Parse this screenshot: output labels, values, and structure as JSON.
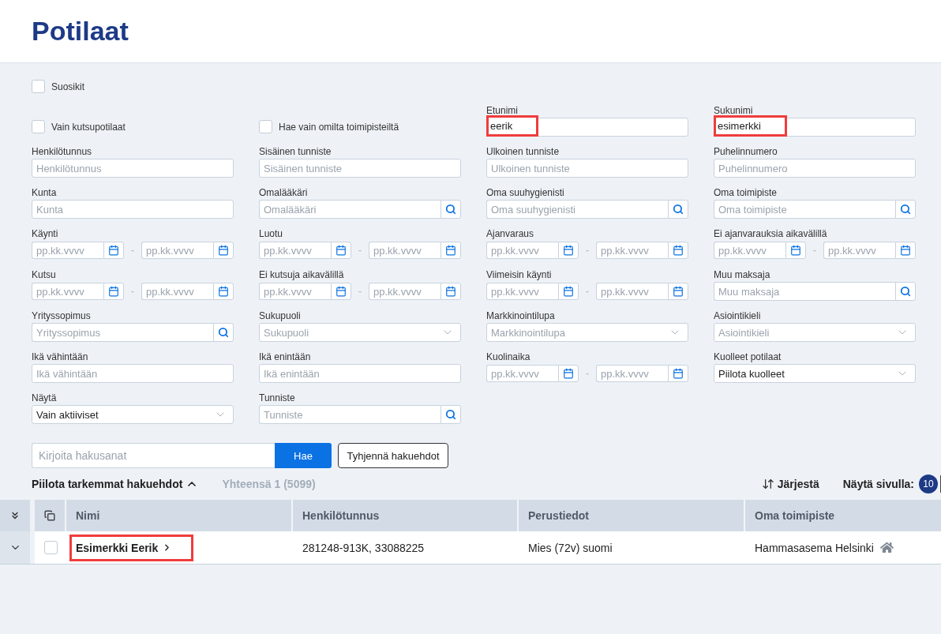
{
  "page": {
    "title": "Potilaat"
  },
  "filters": {
    "favorites": {
      "label": "Suosikit",
      "checked": false
    },
    "fields": [
      {
        "kind": "checkbox",
        "label": "Vain kutsupotilaat",
        "checked": false,
        "highlighted": false
      },
      {
        "kind": "checkbox",
        "label": "Hae vain omilta toimipisteiltä",
        "checked": false,
        "highlighted": false
      },
      {
        "kind": "text",
        "label": "Etunimi",
        "value": "eerik",
        "highlighted": true
      },
      {
        "kind": "text",
        "label": "Sukunimi",
        "value": "esimerkki",
        "highlighted": true
      },
      {
        "kind": "text",
        "label": "Henkilötunnus",
        "placeholder": "Henkilötunnus",
        "highlighted": false
      },
      {
        "kind": "text",
        "label": "Sisäinen tunniste",
        "placeholder": "Sisäinen tunniste",
        "highlighted": false
      },
      {
        "kind": "text",
        "label": "Ulkoinen tunniste",
        "placeholder": "Ulkoinen tunniste",
        "highlighted": false
      },
      {
        "kind": "text",
        "label": "Puhelinnumero",
        "placeholder": "Puhelinnumero",
        "highlighted": false
      },
      {
        "kind": "text",
        "label": "Kunta",
        "placeholder": "Kunta",
        "highlighted": false
      },
      {
        "kind": "lookup",
        "label": "Omalääkäri",
        "placeholder": "Omalääkäri",
        "highlighted": false
      },
      {
        "kind": "lookup",
        "label": "Oma suuhygienisti",
        "placeholder": "Oma suuhygienisti",
        "highlighted": false
      },
      {
        "kind": "lookup",
        "label": "Oma toimipiste",
        "placeholder": "Oma toimipiste",
        "highlighted": false
      },
      {
        "kind": "daterange",
        "label": "Käynti",
        "from": {
          "placeholder": "pp.kk.vvvv"
        },
        "separator": "-",
        "to": {
          "placeholder": "pp.kk.vvvv"
        },
        "highlighted": false
      },
      {
        "kind": "daterange",
        "label": "Luotu",
        "from": {
          "placeholder": "pp.kk.vvvv"
        },
        "separator": "-",
        "to": {
          "placeholder": "pp.kk.vvvv"
        },
        "highlighted": false
      },
      {
        "kind": "daterange",
        "label": "Ajanvaraus",
        "from": {
          "placeholder": "pp.kk.vvvv"
        },
        "separator": "-",
        "to": {
          "placeholder": "pp.kk.vvvv"
        },
        "highlighted": false
      },
      {
        "kind": "daterange",
        "label": "Ei ajanvarauksia aikavälillä",
        "from": {
          "placeholder": "pp.kk.vvvv"
        },
        "separator": "-",
        "to": {
          "placeholder": "pp.kk.vvvv"
        },
        "highlighted": false
      },
      {
        "kind": "daterange",
        "label": "Kutsu",
        "from": {
          "placeholder": "pp.kk.vvvv"
        },
        "separator": "-",
        "to": {
          "placeholder": "pp.kk.vvvv"
        },
        "highlighted": false
      },
      {
        "kind": "daterange",
        "label": "Ei kutsuja aikavälillä",
        "from": {
          "placeholder": "pp.kk.vvvv"
        },
        "separator": "-",
        "to": {
          "placeholder": "pp.kk.vvvv"
        },
        "highlighted": false
      },
      {
        "kind": "daterange",
        "label": "Viimeisin käynti",
        "from": {
          "placeholder": "pp.kk.vvvv"
        },
        "separator": "-",
        "to": {
          "placeholder": "pp.kk.vvvv"
        },
        "highlighted": false
      },
      {
        "kind": "lookup",
        "label": "Muu maksaja",
        "placeholder": "Muu maksaja",
        "highlighted": false
      },
      {
        "kind": "lookup",
        "label": "Yrityssopimus",
        "placeholder": "Yrityssopimus",
        "highlighted": false
      },
      {
        "kind": "select",
        "label": "Sukupuoli",
        "placeholder": "Sukupuoli",
        "highlighted": false
      },
      {
        "kind": "select",
        "label": "Markkinointilupa",
        "placeholder": "Markkinointilupa",
        "highlighted": false
      },
      {
        "kind": "select",
        "label": "Asiointikieli",
        "placeholder": "Asiointikieli",
        "highlighted": false
      },
      {
        "kind": "text",
        "label": "Ikä vähintään",
        "placeholder": "Ikä vähintään",
        "highlighted": false
      },
      {
        "kind": "text",
        "label": "Ikä enintään",
        "placeholder": "Ikä enintään",
        "highlighted": false
      },
      {
        "kind": "daterange",
        "label": "Kuolinaika",
        "from": {
          "placeholder": "pp.kk.vvvv"
        },
        "separator": "-",
        "to": {
          "placeholder": "pp.kk.vvvv"
        },
        "highlighted": false
      },
      {
        "kind": "select",
        "label": "Kuolleet potilaat",
        "value": "Piilota kuolleet",
        "highlighted": false
      },
      {
        "kind": "select",
        "label": "Näytä",
        "value": "Vain aktiiviset",
        "highlighted": false
      },
      {
        "kind": "lookup",
        "label": "Tunniste",
        "placeholder": "Tunniste",
        "highlighted": false
      }
    ]
  },
  "search": {
    "placeholder": "Kirjoita hakusanat",
    "button": "Hae",
    "clear_button": "Tyhjennä hakuehdot"
  },
  "results": {
    "toggle": "Piilota tarkemmat hakuehdot",
    "expanded": true,
    "total": "Yhteensä 1 (5099)",
    "sort": "Järjestä",
    "page_size_label": "Näytä sivulla:",
    "page_sizes": [
      {
        "label": "10",
        "selected": true
      }
    ]
  },
  "table": {
    "columns": [
      "Nimi",
      "Henkilötunnus",
      "Perustiedot",
      "Oma toimipiste"
    ],
    "rows": [
      {
        "expanded": false,
        "selected": false,
        "highlighted": true,
        "cells": [
          "Esimerkki Eerik",
          "281248-913K, 33088225",
          "Mies (72v) suomi",
          "Hammasasema Helsinki"
        ]
      }
    ]
  }
}
